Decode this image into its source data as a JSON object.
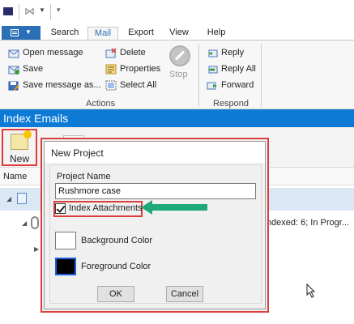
{
  "quick_access": {
    "more_glyph": "▾"
  },
  "tabs": [
    {
      "label": "Search"
    },
    {
      "label": "Mail"
    },
    {
      "label": "Export"
    },
    {
      "label": "View"
    },
    {
      "label": "Help"
    }
  ],
  "ribbon": {
    "actions": {
      "label": "Actions",
      "buttons": [
        {
          "label": "Open message",
          "icon": "open-message-icon"
        },
        {
          "label": "Save",
          "icon": "save-icon"
        },
        {
          "label": "Save message as...",
          "icon": "save-as-icon"
        },
        {
          "label": "Delete",
          "icon": "delete-icon"
        },
        {
          "label": "Properties",
          "icon": "properties-icon"
        },
        {
          "label": "Select All",
          "icon": "select-all-icon"
        },
        {
          "label": "Stop",
          "icon": "stop-icon"
        }
      ]
    },
    "respond": {
      "label": "Respond",
      "buttons": [
        {
          "label": "Reply",
          "icon": "reply-icon"
        },
        {
          "label": "Reply All",
          "icon": "reply-all-icon"
        },
        {
          "label": "Forward",
          "icon": "forward-icon"
        }
      ]
    }
  },
  "panel": {
    "title": "Index Emails"
  },
  "toolbar": {
    "new_label": "New"
  },
  "list": {
    "column_name": "Name",
    "row_status": "s; Indexed: 6; In Progr..."
  },
  "dialog": {
    "title": "New Project",
    "project_name_label": "Project Name",
    "project_name_value": "Rushmore case",
    "index_attachments_label": "Index Attachments",
    "index_attachments_checked": true,
    "background_color_label": "Background Color",
    "background_color": "#ffffff",
    "foreground_color_label": "Foreground Color",
    "foreground_color": "#000000",
    "ok_label": "OK",
    "cancel_label": "Cancel"
  },
  "colors": {
    "accent": "#2b6fb6",
    "header_blue": "#0d7ad6",
    "highlight_red": "#e03b3b",
    "arrow_green": "#1ea97c"
  }
}
